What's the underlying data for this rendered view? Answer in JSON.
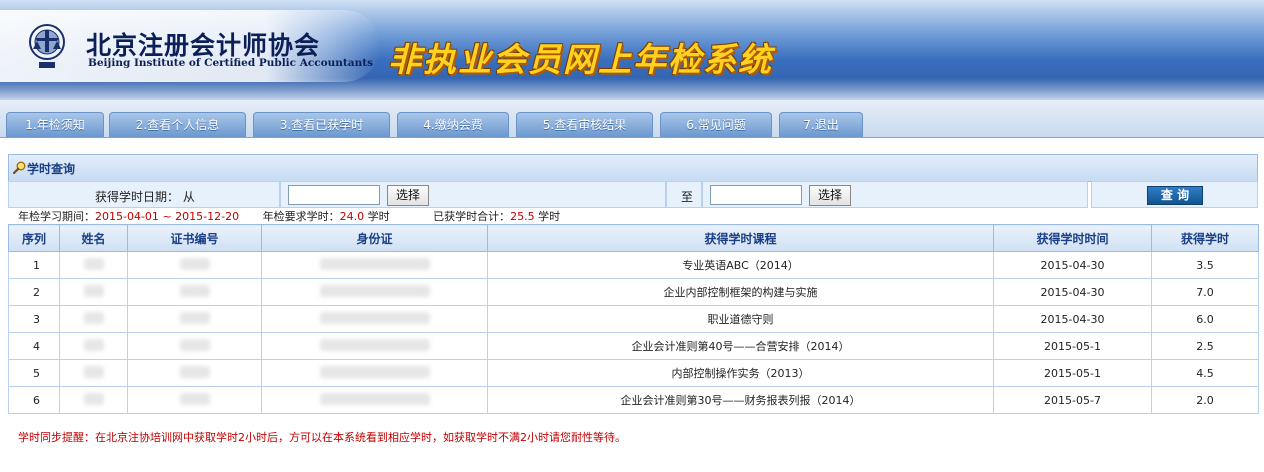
{
  "header": {
    "org_name_cn": "北京注册会计师协会",
    "org_name_en": "Beijing Institute of Certified Public Accountants",
    "system_title": "非执业会员网上年检系统",
    "emblem_icon": "institute-emblem-icon"
  },
  "nav": {
    "tabs": [
      {
        "label": "1.年检须知"
      },
      {
        "label": "2.查看个人信息"
      },
      {
        "label": "3.查看已获学时"
      },
      {
        "label": "4.缴纳会费"
      },
      {
        "label": "5.查看审核结果"
      },
      {
        "label": "6.常见问题"
      },
      {
        "label": "7.退出"
      }
    ]
  },
  "query": {
    "section_title": "学时查询",
    "date_label": "获得学时日期： 从",
    "from_value": "",
    "to_label": "至",
    "to_value": "",
    "pick_label": "选择",
    "query_label": "查 询"
  },
  "summary": {
    "period_label": "年检学习期间：",
    "period_start": "2015-04-01",
    "period_sep": "~",
    "period_end": "2015-12-20",
    "required_label": "年检要求学时：",
    "required_value": "24.0",
    "required_unit": "学时",
    "total_label": "已获学时合计：",
    "total_value": "25.5",
    "total_unit": "学时"
  },
  "table": {
    "columns": [
      "序列",
      "姓名",
      "证书编号",
      "身份证",
      "获得学时课程",
      "获得学时时间",
      "获得学时"
    ],
    "rows": [
      {
        "seq": "1",
        "course": "专业英语ABC（2014）",
        "date": "2015-04-30",
        "hours": "3.5"
      },
      {
        "seq": "2",
        "course": "企业内部控制框架的构建与实施",
        "date": "2015-04-30",
        "hours": "7.0"
      },
      {
        "seq": "3",
        "course": "职业道德守则",
        "date": "2015-04-30",
        "hours": "6.0"
      },
      {
        "seq": "4",
        "course": "企业会计准则第40号——合营安排（2014）",
        "date": "2015-05-1",
        "hours": "2.5"
      },
      {
        "seq": "5",
        "course": "内部控制操作实务（2013）",
        "date": "2015-05-1",
        "hours": "4.5"
      },
      {
        "seq": "6",
        "course": "企业会计准则第30号——财务报表列报（2014）",
        "date": "2015-05-7",
        "hours": "2.0"
      }
    ]
  },
  "notice": "学时同步提醒：在北京注协培训网中获取学时2小时后，方可以在本系统看到相应学时，如获取学时不满2小时请您耐性等待。",
  "colors": {
    "accent_red": "#c00000",
    "header_blue": "#2c5aa6",
    "title_yellow": "#ffd21f"
  }
}
